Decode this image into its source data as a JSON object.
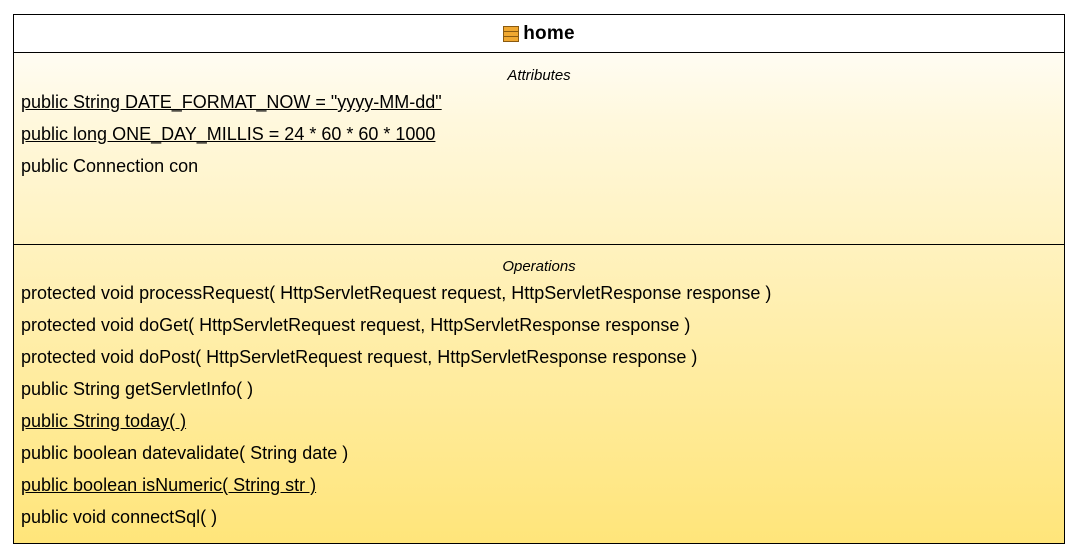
{
  "class_box": {
    "name": "home",
    "icon": "class-icon",
    "colors": {
      "fill_top": "#ffffff",
      "fill_bottom": "#ffe57a",
      "border": "#000000",
      "icon_fill": "#f0a830"
    }
  },
  "attributes": {
    "title": "Attributes",
    "items": [
      {
        "text": "public String DATE_FORMAT_NOW = \"yyyy-MM-dd\"",
        "static": true
      },
      {
        "text": "public long ONE_DAY_MILLIS = 24 * 60 * 60 * 1000",
        "static": true
      },
      {
        "text": "public Connection con",
        "static": false
      }
    ]
  },
  "operations": {
    "title": "Operations",
    "items": [
      {
        "text": "protected void  processRequest( HttpServletRequest request, HttpServletResponse response )",
        "static": false
      },
      {
        "text": "protected void  doGet( HttpServletRequest request, HttpServletResponse response )",
        "static": false
      },
      {
        "text": "protected void  doPost( HttpServletRequest request, HttpServletResponse response )",
        "static": false
      },
      {
        "text": "public String  getServletInfo( )",
        "static": false
      },
      {
        "text": "public String  today( )",
        "static": true
      },
      {
        "text": "public boolean  datevalidate( String date )",
        "static": false
      },
      {
        "text": "public boolean  isNumeric( String str )",
        "static": true
      },
      {
        "text": "public void  connectSql( )",
        "static": false
      }
    ]
  }
}
